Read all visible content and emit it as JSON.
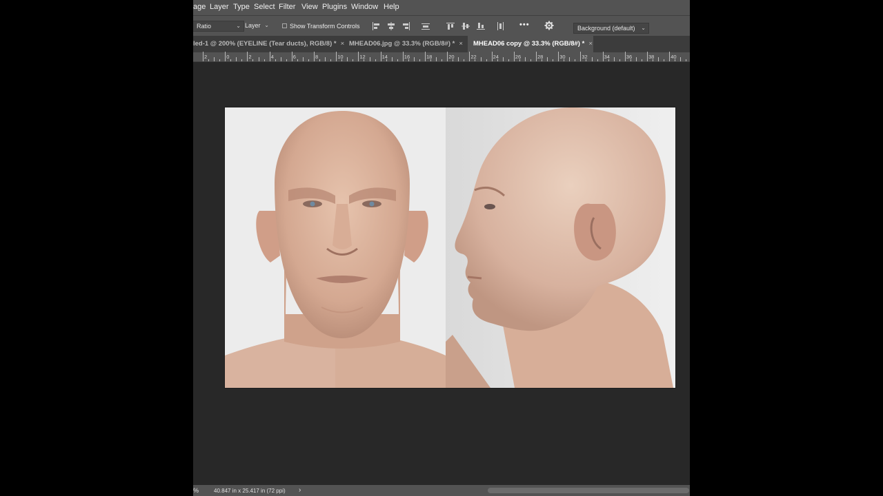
{
  "menubar": {
    "items": [
      "age",
      "Layer",
      "Type",
      "Select",
      "Filter",
      "View",
      "Plugins",
      "Window",
      "Help"
    ]
  },
  "options": {
    "ratio_label": "Ratio",
    "layer_label": "Layer",
    "show_transform_label": "Show Transform Controls",
    "more_label": "•••",
    "background_select": "Background (default)"
  },
  "tabs": [
    {
      "label": "led-1 @ 200% (EYELINE (Tear ducts), RGB/8) *",
      "active": false
    },
    {
      "label": "MHEAD06.jpg @ 33.3% (RGB/8#) *",
      "active": false
    },
    {
      "label": "MHEAD06 copy @ 33.3% (RGB/8#) *",
      "active": true
    }
  ],
  "tab_close": "×",
  "ruler": {
    "labels": [
      "2",
      "0",
      "2",
      "4",
      "6",
      "8",
      "10",
      "12",
      "14",
      "16",
      "18",
      "20",
      "22",
      "24",
      "26",
      "28",
      "30",
      "32",
      "34",
      "36",
      "38",
      "40"
    ]
  },
  "status": {
    "zoom": "%",
    "doc_size": "40.847 in x 25.417 in (72 ppi)",
    "arrow": "›"
  },
  "colors": {
    "panel": "#535353",
    "workspace": "#282828",
    "tabbar": "#3c3c3c"
  }
}
